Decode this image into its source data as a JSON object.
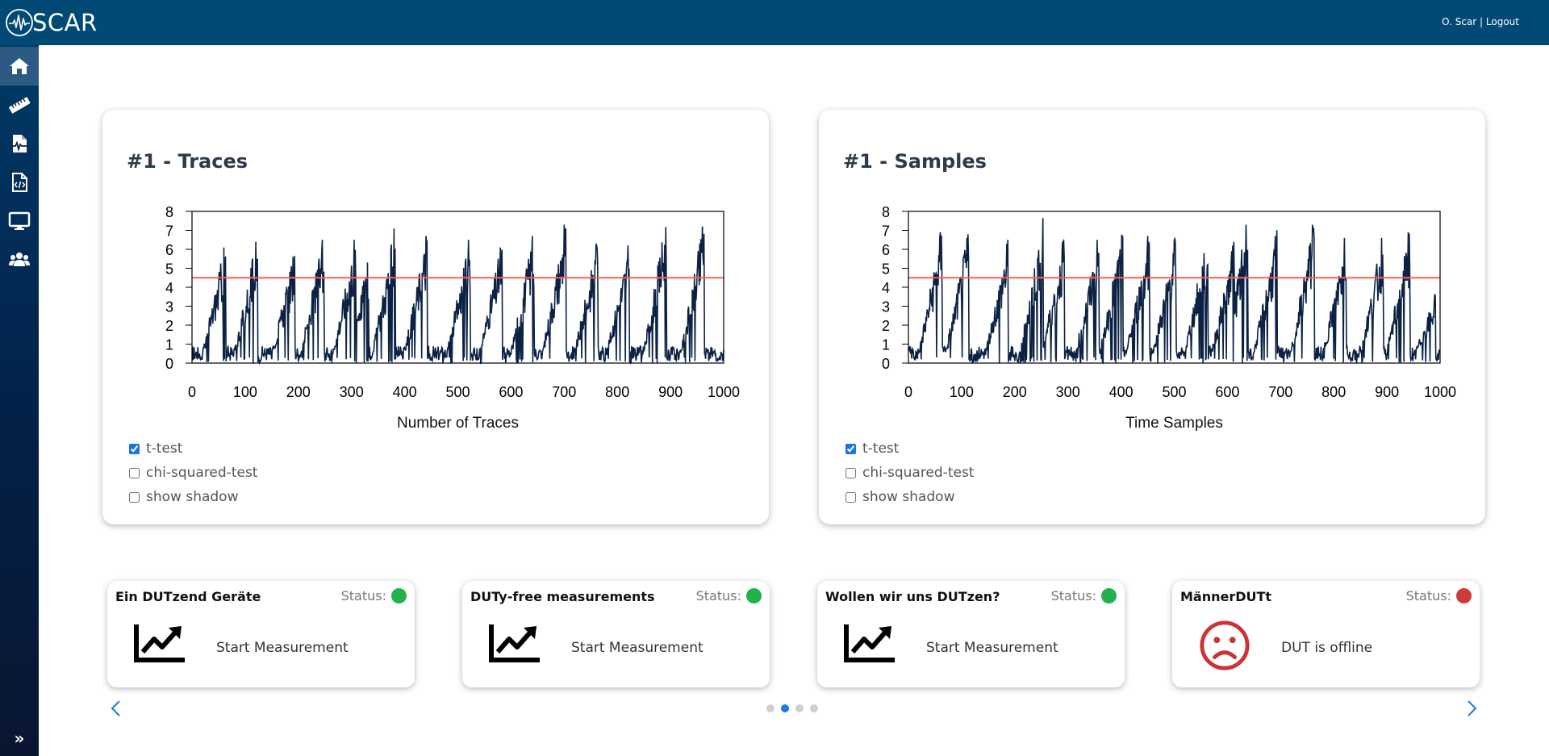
{
  "header": {
    "logo_text": "SCAR",
    "user": "O. Scar",
    "separator": "|",
    "logout": "Logout"
  },
  "sidebar": {
    "items": [
      {
        "icon": "home-icon",
        "active": true
      },
      {
        "icon": "ruler-icon",
        "active": false
      },
      {
        "icon": "file-waveform-icon",
        "active": false
      },
      {
        "icon": "file-code-icon",
        "active": false
      },
      {
        "icon": "monitor-icon",
        "active": false
      },
      {
        "icon": "users-icon",
        "active": false
      }
    ],
    "expand_label": "»"
  },
  "charts": [
    {
      "title": "#1 - Traces",
      "xlabel": "Number of Traces",
      "options": [
        {
          "label": "t-test",
          "checked": true
        },
        {
          "label": "chi-squared-test",
          "checked": false
        },
        {
          "label": "show shadow",
          "checked": false
        }
      ]
    },
    {
      "title": "#1 - Samples",
      "xlabel": "Time Samples",
      "options": [
        {
          "label": "t-test",
          "checked": true
        },
        {
          "label": "chi-squared-test",
          "checked": false
        },
        {
          "label": "show shadow",
          "checked": false
        }
      ]
    }
  ],
  "chart_data": [
    {
      "type": "line",
      "xlabel": "Number of Traces",
      "xlim": [
        0,
        1000
      ],
      "ylim": [
        0,
        8
      ],
      "xticks": [
        0,
        100,
        200,
        300,
        400,
        500,
        600,
        700,
        800,
        900,
        1000
      ],
      "yticks": [
        0,
        1,
        2,
        3,
        4,
        5,
        6,
        7,
        8
      ],
      "threshold": 4.5,
      "threshold_color": "#ff5c5c",
      "series_color": "#0b2244",
      "peaks": [
        [
          60,
          6.1
        ],
        [
          120,
          6.4
        ],
        [
          190,
          5.6
        ],
        [
          245,
          6.5
        ],
        [
          305,
          6.5
        ],
        [
          330,
          5.3
        ],
        [
          380,
          7.1
        ],
        [
          440,
          6.7
        ],
        [
          520,
          6.5
        ],
        [
          580,
          6.1
        ],
        [
          640,
          6.7
        ],
        [
          700,
          7.3
        ],
        [
          760,
          6.3
        ],
        [
          820,
          6.2
        ],
        [
          890,
          7.5
        ],
        [
          960,
          7.2
        ]
      ]
    },
    {
      "type": "line",
      "xlabel": "Time Samples",
      "xlim": [
        0,
        1000
      ],
      "ylim": [
        0,
        8
      ],
      "xticks": [
        0,
        100,
        200,
        300,
        400,
        500,
        600,
        700,
        800,
        900,
        1000
      ],
      "yticks": [
        0,
        1,
        2,
        3,
        4,
        5,
        6,
        7,
        8
      ],
      "threshold": 4.5,
      "threshold_color": "#ff5c5c",
      "series_color": "#0b2244",
      "peaks": [
        [
          60,
          6.9
        ],
        [
          110,
          6.6
        ],
        [
          185,
          6.3
        ],
        [
          250,
          7.4
        ],
        [
          290,
          6.4
        ],
        [
          355,
          6.5
        ],
        [
          400,
          6.8
        ],
        [
          450,
          6.7
        ],
        [
          500,
          6.5
        ],
        [
          560,
          6.8
        ],
        [
          610,
          6.2
        ],
        [
          635,
          7.3
        ],
        [
          690,
          6.7
        ],
        [
          760,
          7.3
        ],
        [
          820,
          6.6
        ],
        [
          890,
          6.6
        ],
        [
          940,
          6.9
        ],
        [
          990,
          3.6
        ]
      ]
    }
  ],
  "devices": [
    {
      "name": "Ein DUTzend Geräte",
      "status_label": "Status:",
      "status_color": "#22b14c",
      "action": "Start Measurement",
      "icon": "chart-line-icon"
    },
    {
      "name": "DUTy-free measurements",
      "status_label": "Status:",
      "status_color": "#22b14c",
      "action": "Start Measurement",
      "icon": "chart-line-icon"
    },
    {
      "name": "Wollen wir uns DUTzen?",
      "status_label": "Status:",
      "status_color": "#22b14c",
      "action": "Start Measurement",
      "icon": "chart-line-icon"
    },
    {
      "name": "MännerDUTt",
      "status_label": "Status:",
      "status_color": "#d03a3a",
      "action": "DUT is offline",
      "icon": "sad-face-icon"
    }
  ],
  "carousel": {
    "pages": 4,
    "active_page": 2
  }
}
